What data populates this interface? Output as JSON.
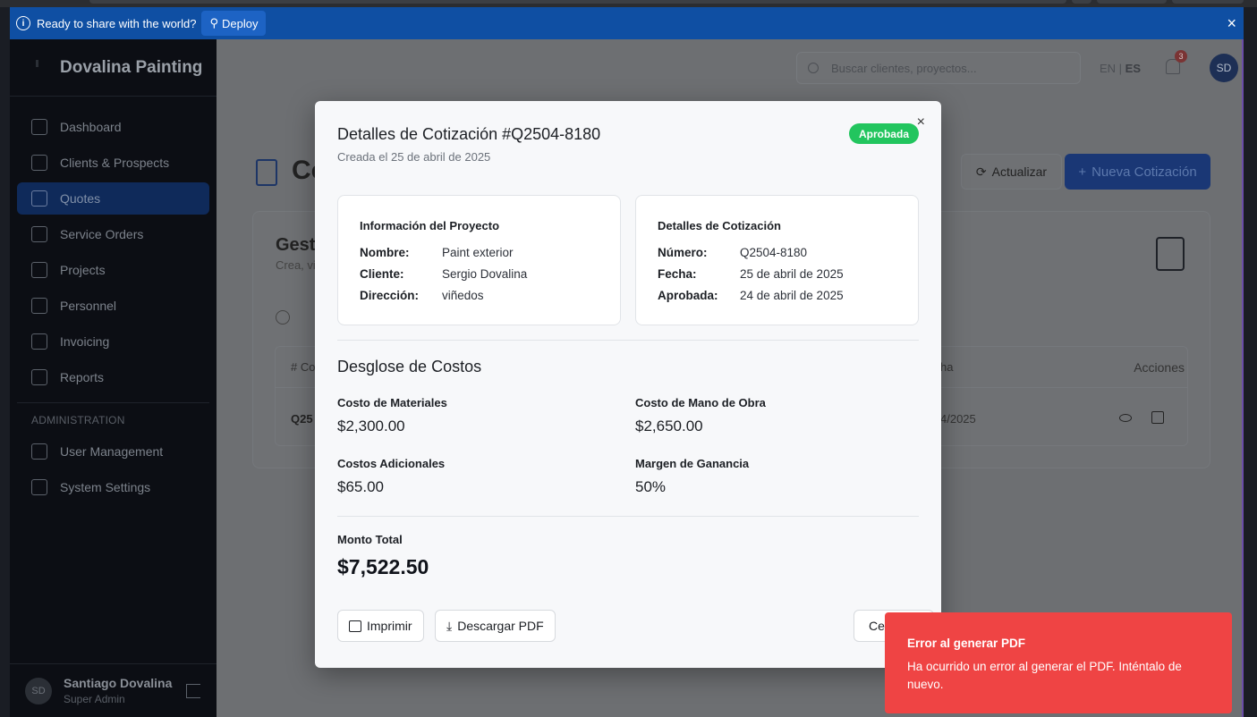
{
  "banner": {
    "message": "Ready to share with the world?",
    "deploy_label": "Deploy",
    "close_glyph": "×"
  },
  "sidebar": {
    "brand": "Dovalina Painting",
    "items": [
      {
        "label": "Dashboard",
        "icon": "trending-up-icon"
      },
      {
        "label": "Clients & Prospects",
        "icon": "users-icon"
      },
      {
        "label": "Quotes",
        "icon": "file-text-icon",
        "active": true
      },
      {
        "label": "Service Orders",
        "icon": "clipboard-icon"
      },
      {
        "label": "Projects",
        "icon": "git-branch-icon"
      },
      {
        "label": "Personnel",
        "icon": "hard-hat-icon"
      },
      {
        "label": "Invoicing",
        "icon": "file-icon"
      },
      {
        "label": "Reports",
        "icon": "bar-chart-icon"
      }
    ],
    "admin_label": "ADMINISTRATION",
    "admin_items": [
      {
        "label": "User Management",
        "icon": "user-cog-icon"
      },
      {
        "label": "System Settings",
        "icon": "gear-icon"
      }
    ],
    "user": {
      "initials": "SD",
      "name": "Santiago Dovalina",
      "role": "Super Admin"
    }
  },
  "topbar": {
    "search_placeholder": "Buscar clientes, proyectos...",
    "lang_en": "EN",
    "lang_sep": " | ",
    "lang_es": "ES",
    "notifications": "3",
    "avatar": "SD"
  },
  "page": {
    "title_partial": "Co",
    "refresh_label": "Actualizar",
    "new_label": "Nueva Cotización",
    "card_title_partial": "Gest",
    "card_sub_partial": "Crea, vi",
    "col_number_partial": "# Co",
    "col_date_partial": "ha",
    "col_actions": "Acciones",
    "row_number_partial": "Q25",
    "row_date_partial": "4/2025"
  },
  "modal": {
    "title": "Detalles de Cotización #Q2504-8180",
    "subtitle": "Creada el 25 de abril de 2025",
    "status": "Aprobada",
    "close_glyph": "×",
    "project": {
      "heading": "Información del Proyecto",
      "rows": [
        {
          "k": "Nombre:",
          "v": "Paint exterior"
        },
        {
          "k": "Cliente:",
          "v": "Sergio Dovalina"
        },
        {
          "k": "Dirección:",
          "v": "viñedos"
        }
      ]
    },
    "quote": {
      "heading": "Detalles de Cotización",
      "rows": [
        {
          "k": "Número:",
          "v": "Q2504-8180"
        },
        {
          "k": "Fecha:",
          "v": "25 de abril de 2025"
        },
        {
          "k": "Aprobada:",
          "v": "24 de abril de 2025"
        }
      ]
    },
    "costs_title": "Desglose de Costos",
    "costs": {
      "materials_label": "Costo de Materiales",
      "materials_value": "$2,300.00",
      "labor_label": "Costo de Mano de Obra",
      "labor_value": "$2,650.00",
      "additional_label": "Costos Adicionales",
      "additional_value": "$65.00",
      "margin_label": "Margen de Ganancia",
      "margin_value": "50%"
    },
    "total_label": "Monto Total",
    "total_value": "$7,522.50",
    "print_label": "Imprimir",
    "download_label": "Descargar PDF",
    "close_label_partial": "Ce"
  },
  "toast": {
    "title": "Error al generar PDF",
    "message": "Ha ocurrido un error al generar el PDF. Inténtalo de nuevo."
  },
  "colors": {
    "banner": "#0f4fa3",
    "status_badge": "#22c55e",
    "toast": "#ef4444"
  }
}
